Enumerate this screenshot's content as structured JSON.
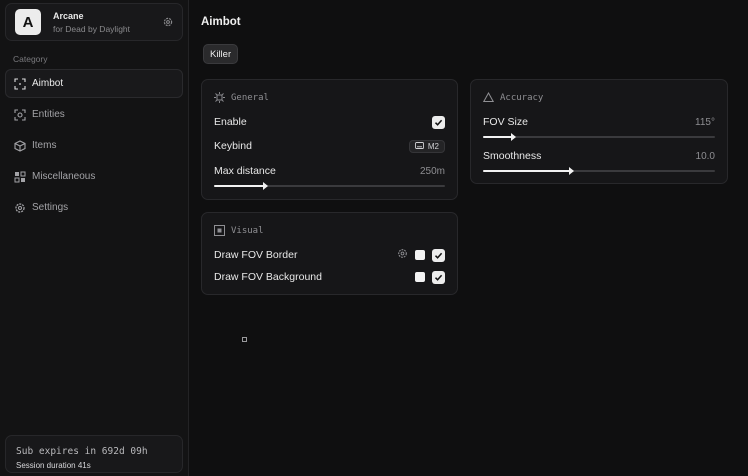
{
  "brand": {
    "logo_letter": "A",
    "name": "Arcane",
    "subtitle": "for Dead by Daylight"
  },
  "sidebar": {
    "category_label": "Category",
    "items": [
      {
        "label": "Aimbot",
        "icon": "crosshair-icon",
        "active": true
      },
      {
        "label": "Entities",
        "icon": "target-icon",
        "active": false
      },
      {
        "label": "Items",
        "icon": "cube-icon",
        "active": false
      },
      {
        "label": "Miscellaneous",
        "icon": "grid-icon",
        "active": false
      },
      {
        "label": "Settings",
        "icon": "gear-icon",
        "active": false
      }
    ],
    "footer": {
      "expires": "Sub expires in 692d 09h",
      "session": "Session duration 41s"
    }
  },
  "main": {
    "title": "Aimbot",
    "chip": "Killer",
    "general": {
      "title": "General",
      "enable_label": "Enable",
      "enable_checked": true,
      "keybind_label": "Keybind",
      "keybind_value": "M2",
      "max_distance_label": "Max distance",
      "max_distance_value": "250m",
      "max_distance_fraction": 0.22
    },
    "visual": {
      "title": "Visual",
      "fov_border_label": "Draw FOV Border",
      "fov_border_checked": true,
      "fov_background_label": "Draw FOV Background",
      "fov_background_checked": true
    },
    "accuracy": {
      "title": "Accuracy",
      "fov_size_label": "FOV Size",
      "fov_size_value": "115°",
      "fov_size_fraction": 0.13,
      "smoothness_label": "Smoothness",
      "smoothness_value": "10.0",
      "smoothness_fraction": 0.38
    }
  },
  "colors": {
    "background": "#0f0f10",
    "panel": "#161618",
    "accent": "#f2f2f2"
  }
}
